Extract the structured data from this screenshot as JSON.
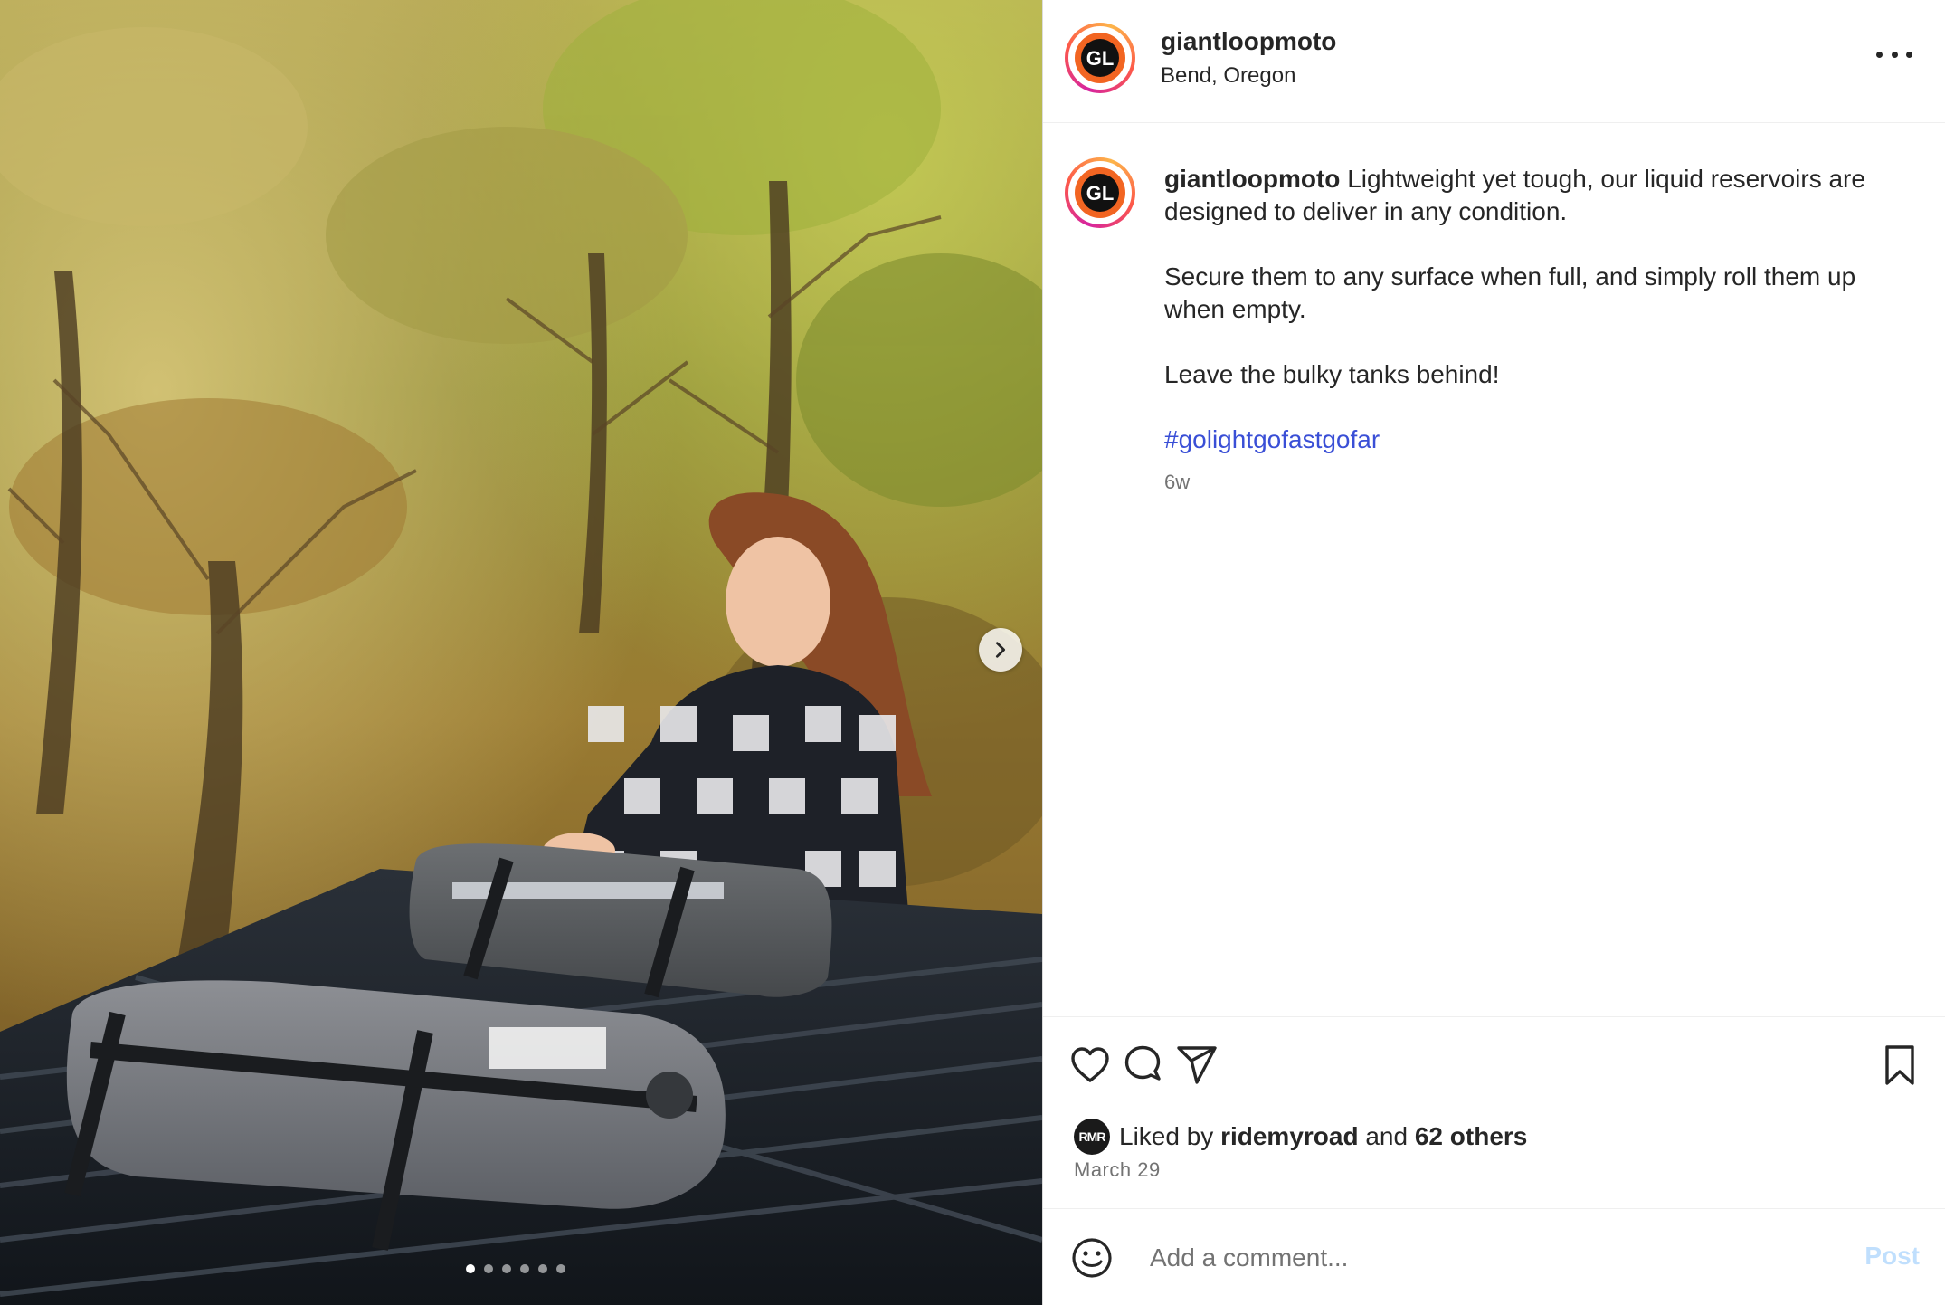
{
  "post": {
    "username": "giantloopmoto",
    "location": "Bend, Oregon",
    "avatar_initials": "GL",
    "caption": {
      "user": "giantloopmoto",
      "first_line": "Lightweight yet tough, our liquid reservoirs are designed to deliver in any condition.",
      "paragraph_2": "Secure them to any surface when full, and simply roll them up when empty.",
      "paragraph_3": "Leave the bulky tanks behind!",
      "hashtag": "#golightgofastgofar"
    },
    "time_ago": "6w",
    "likes": {
      "prefix": "Liked by",
      "liker": "ridemyroad",
      "conjunction": "and",
      "others": "62 others",
      "liker_avatar": "RMR"
    },
    "date": "March 29",
    "comment": {
      "placeholder": "Add a comment...",
      "post_label": "Post"
    },
    "carousel": {
      "slide_count": 6,
      "active_index": 0
    }
  },
  "icons": {
    "more": "more-options-icon",
    "next": "chevron-right-icon",
    "like": "heart-icon",
    "comment": "comment-icon",
    "share": "send-icon",
    "save": "bookmark-icon",
    "emoji": "smiley-icon"
  },
  "colors": {
    "hashtag": "#3a4fd6",
    "post_disabled": "#c0dffd",
    "muted_text": "#737373",
    "avatar_ring_start": "#d6249f",
    "avatar_ring_end": "#fdb54a",
    "logo_orange": "#f26522"
  }
}
